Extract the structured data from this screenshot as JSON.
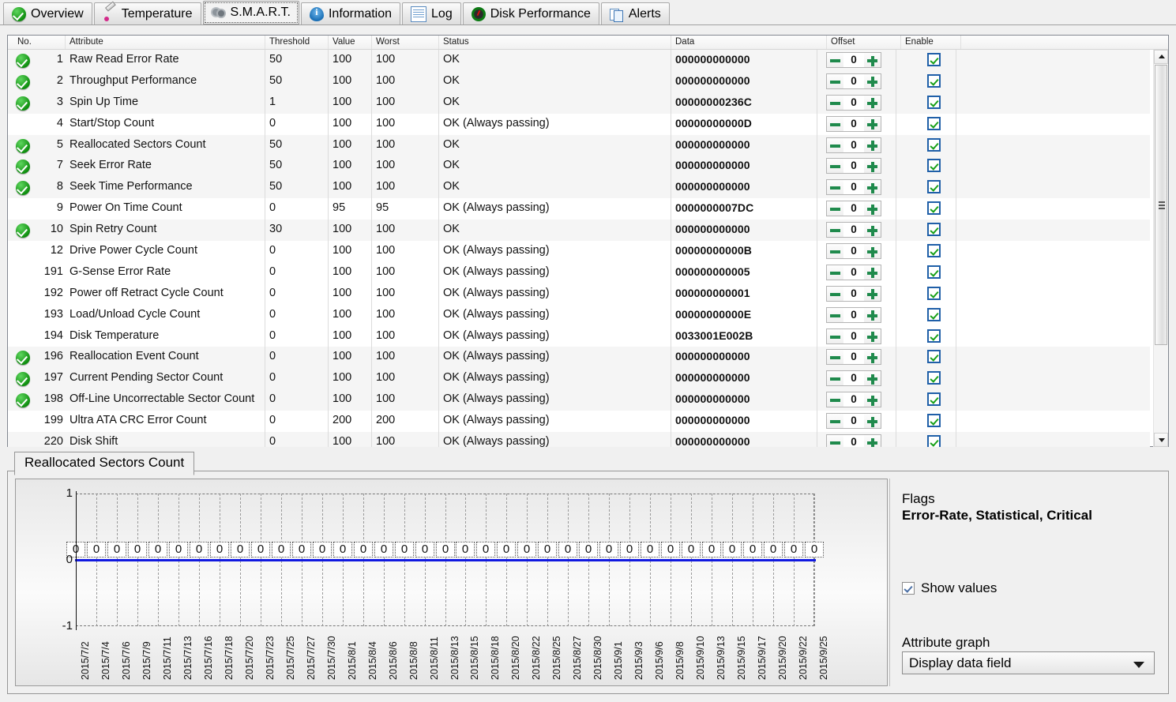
{
  "tabs": [
    {
      "label": "Overview",
      "icon": "green-check-icon",
      "active": false
    },
    {
      "label": "Temperature",
      "icon": "thermometer-icon",
      "active": false
    },
    {
      "label": "S.M.A.R.T.",
      "icon": "gears-icon",
      "active": true
    },
    {
      "label": "Information",
      "icon": "info-icon",
      "active": false
    },
    {
      "label": "Log",
      "icon": "document-icon",
      "active": false
    },
    {
      "label": "Disk Performance",
      "icon": "gauge-icon",
      "active": false
    },
    {
      "label": "Alerts",
      "icon": "copies-icon",
      "active": false
    }
  ],
  "table": {
    "columns": [
      "No.",
      "Attribute",
      "Threshold",
      "Value",
      "Worst",
      "Status",
      "Data",
      "Offset",
      "Enable"
    ],
    "rows": [
      {
        "health": true,
        "no": "1",
        "attribute": "Raw Read Error Rate",
        "threshold": "50",
        "value": "100",
        "worst": "100",
        "status": "OK",
        "data": "000000000000",
        "offset": "0",
        "enable": true
      },
      {
        "health": true,
        "no": "2",
        "attribute": "Throughput Performance",
        "threshold": "50",
        "value": "100",
        "worst": "100",
        "status": "OK",
        "data": "000000000000",
        "offset": "0",
        "enable": true
      },
      {
        "health": true,
        "no": "3",
        "attribute": "Spin Up Time",
        "threshold": "1",
        "value": "100",
        "worst": "100",
        "status": "OK",
        "data": "00000000236C",
        "offset": "0",
        "enable": true
      },
      {
        "health": false,
        "no": "4",
        "attribute": "Start/Stop Count",
        "threshold": "0",
        "value": "100",
        "worst": "100",
        "status": "OK (Always passing)",
        "data": "00000000000D",
        "offset": "0",
        "enable": true
      },
      {
        "health": true,
        "no": "5",
        "attribute": "Reallocated Sectors Count",
        "threshold": "50",
        "value": "100",
        "worst": "100",
        "status": "OK",
        "data": "000000000000",
        "offset": "0",
        "enable": true
      },
      {
        "health": true,
        "no": "7",
        "attribute": "Seek Error Rate",
        "threshold": "50",
        "value": "100",
        "worst": "100",
        "status": "OK",
        "data": "000000000000",
        "offset": "0",
        "enable": true
      },
      {
        "health": true,
        "no": "8",
        "attribute": "Seek Time Performance",
        "threshold": "50",
        "value": "100",
        "worst": "100",
        "status": "OK",
        "data": "000000000000",
        "offset": "0",
        "enable": true
      },
      {
        "health": false,
        "no": "9",
        "attribute": "Power On Time Count",
        "threshold": "0",
        "value": "95",
        "worst": "95",
        "status": "OK (Always passing)",
        "data": "0000000007DC",
        "offset": "0",
        "enable": true
      },
      {
        "health": true,
        "no": "10",
        "attribute": "Spin Retry Count",
        "threshold": "30",
        "value": "100",
        "worst": "100",
        "status": "OK",
        "data": "000000000000",
        "offset": "0",
        "enable": true
      },
      {
        "health": false,
        "no": "12",
        "attribute": "Drive Power Cycle Count",
        "threshold": "0",
        "value": "100",
        "worst": "100",
        "status": "OK (Always passing)",
        "data": "00000000000B",
        "offset": "0",
        "enable": true
      },
      {
        "health": false,
        "no": "191",
        "attribute": "G-Sense Error Rate",
        "threshold": "0",
        "value": "100",
        "worst": "100",
        "status": "OK (Always passing)",
        "data": "000000000005",
        "offset": "0",
        "enable": true
      },
      {
        "health": false,
        "no": "192",
        "attribute": "Power off Retract Cycle Count",
        "threshold": "0",
        "value": "100",
        "worst": "100",
        "status": "OK (Always passing)",
        "data": "000000000001",
        "offset": "0",
        "enable": true
      },
      {
        "health": false,
        "no": "193",
        "attribute": "Load/Unload Cycle Count",
        "threshold": "0",
        "value": "100",
        "worst": "100",
        "status": "OK (Always passing)",
        "data": "00000000000E",
        "offset": "0",
        "enable": true
      },
      {
        "health": false,
        "no": "194",
        "attribute": "Disk Temperature",
        "threshold": "0",
        "value": "100",
        "worst": "100",
        "status": "OK (Always passing)",
        "data": "0033001E002B",
        "offset": "0",
        "enable": true
      },
      {
        "health": true,
        "no": "196",
        "attribute": "Reallocation Event Count",
        "threshold": "0",
        "value": "100",
        "worst": "100",
        "status": "OK (Always passing)",
        "data": "000000000000",
        "offset": "0",
        "enable": true
      },
      {
        "health": true,
        "no": "197",
        "attribute": "Current Pending Sector Count",
        "threshold": "0",
        "value": "100",
        "worst": "100",
        "status": "OK (Always passing)",
        "data": "000000000000",
        "offset": "0",
        "enable": true
      },
      {
        "health": true,
        "no": "198",
        "attribute": "Off-Line Uncorrectable Sector Count",
        "threshold": "0",
        "value": "100",
        "worst": "100",
        "status": "OK (Always passing)",
        "data": "000000000000",
        "offset": "0",
        "enable": true
      },
      {
        "health": false,
        "no": "199",
        "attribute": "Ultra ATA CRC Error Count",
        "threshold": "0",
        "value": "200",
        "worst": "200",
        "status": "OK (Always passing)",
        "data": "000000000000",
        "offset": "0",
        "enable": true
      },
      {
        "health": false,
        "no": "220",
        "attribute": "Disk Shift",
        "threshold": "0",
        "value": "100",
        "worst": "100",
        "status": "OK (Always passing)",
        "data": "000000000000",
        "offset": "0",
        "enable": true
      }
    ]
  },
  "graph": {
    "tab_label": "Reallocated Sectors Count",
    "flags_title": "Flags",
    "flags_value": "Error-Rate, Statistical, Critical",
    "show_values_label": "Show values",
    "show_values_checked": true,
    "attribute_graph_label": "Attribute graph",
    "attribute_graph_selected": "Display data field"
  },
  "chart_data": {
    "type": "line",
    "title": "Reallocated Sectors Count",
    "xlabel": "",
    "ylabel": "",
    "ylim": [
      -1,
      1
    ],
    "yticks": [
      "1",
      "0",
      "-1"
    ],
    "grid": true,
    "legend": "none",
    "show_values": true,
    "categories": [
      "2015/7/2",
      "2015/7/4",
      "2015/7/6",
      "2015/7/9",
      "2015/7/11",
      "2015/7/13",
      "2015/7/16",
      "2015/7/18",
      "2015/7/20",
      "2015/7/23",
      "2015/7/25",
      "2015/7/27",
      "2015/7/30",
      "2015/8/1",
      "2015/8/4",
      "2015/8/6",
      "2015/8/8",
      "2015/8/11",
      "2015/8/13",
      "2015/8/15",
      "2015/8/18",
      "2015/8/20",
      "2015/8/22",
      "2015/8/25",
      "2015/8/27",
      "2015/8/30",
      "2015/9/1",
      "2015/9/3",
      "2015/9/6",
      "2015/9/8",
      "2015/9/10",
      "2015/9/13",
      "2015/9/15",
      "2015/9/17",
      "2015/9/20",
      "2015/9/22",
      "2015/9/25"
    ],
    "values": [
      0,
      0,
      0,
      0,
      0,
      0,
      0,
      0,
      0,
      0,
      0,
      0,
      0,
      0,
      0,
      0,
      0,
      0,
      0,
      0,
      0,
      0,
      0,
      0,
      0,
      0,
      0,
      0,
      0,
      0,
      0,
      0,
      0,
      0,
      0,
      0,
      0
    ],
    "point_labels": [
      "0",
      "0",
      "0",
      "0",
      "0",
      "0",
      "0",
      "0",
      "0",
      "0",
      "0",
      "0",
      "0",
      "0",
      "0",
      "0",
      "0",
      "0",
      "0",
      "0",
      "0",
      "0",
      "0",
      "0",
      "0",
      "0",
      "0",
      "0",
      "0",
      "0",
      "0",
      "0",
      "0",
      "0",
      "0",
      "0",
      "0"
    ],
    "series_color": "#1119e0"
  }
}
